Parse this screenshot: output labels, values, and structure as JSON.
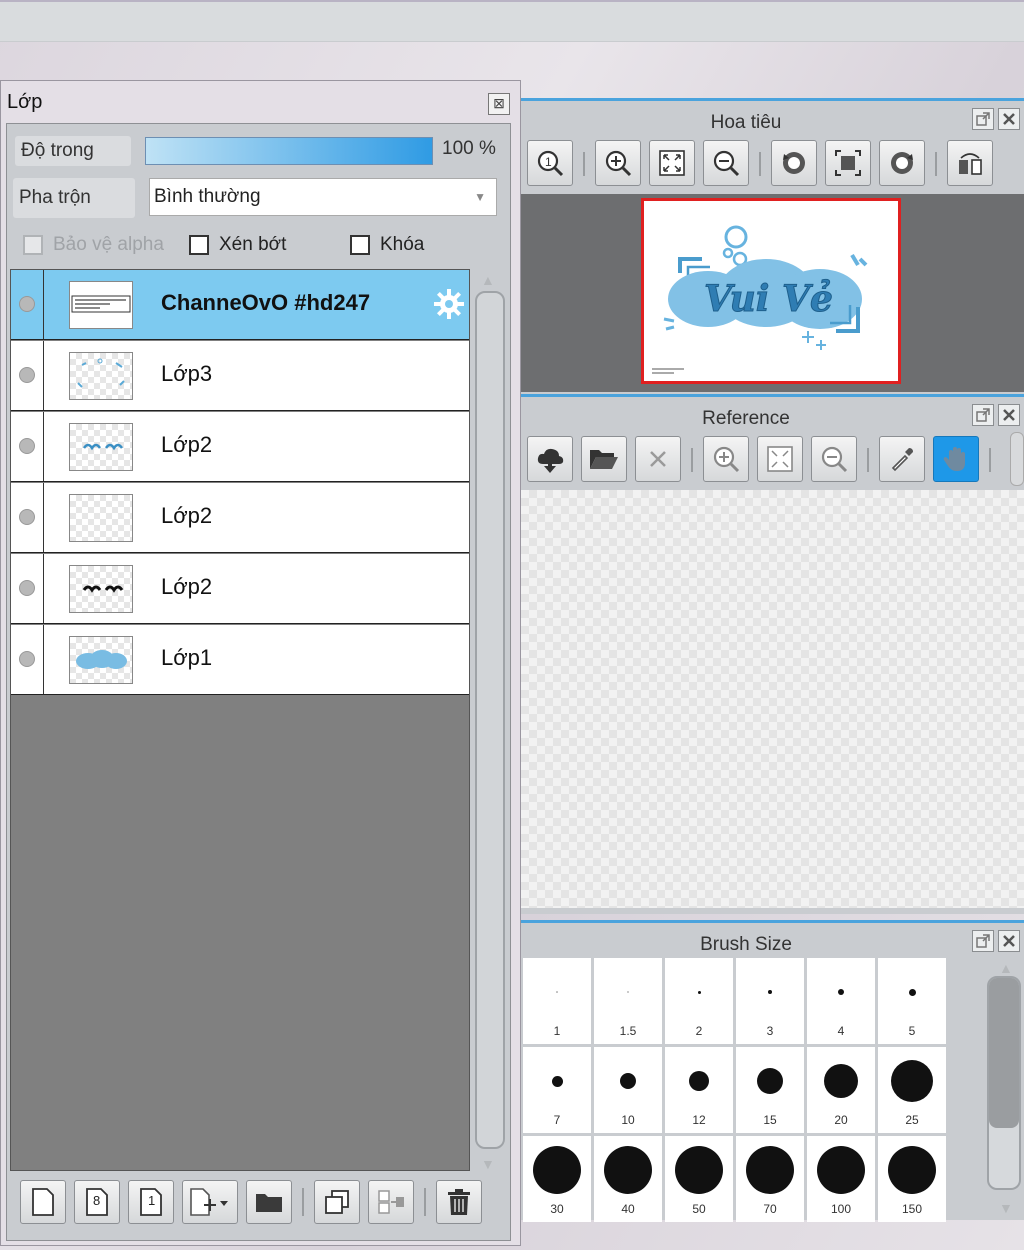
{
  "layers_panel": {
    "title": "Lớp",
    "close_glyph": "⊠",
    "opacity_label": "Độ trong",
    "opacity_value": "100 %",
    "opacity_level": 1.0,
    "blend_label": "Pha trộn",
    "blend_value": "Bình thường",
    "protect_alpha_label": "Bảo vệ alpha",
    "clip_label": "Xén bớt",
    "lock_label": "Khóa",
    "layers": [
      {
        "name": "ChanneOvO #hd247",
        "selected": true
      },
      {
        "name": "Lớp3",
        "selected": false
      },
      {
        "name": "Lớp2",
        "selected": false
      },
      {
        "name": "Lớp2",
        "selected": false
      },
      {
        "name": "Lớp2",
        "selected": false
      },
      {
        "name": "Lớp1",
        "selected": false
      }
    ],
    "toolbar": {
      "new_layer_icon": "new-layer-icon",
      "layer8_label": "8",
      "layer1_label": "1",
      "folder_icon": "folder-icon",
      "duplicate_icon": "duplicate-icon",
      "merge_icon": "merge-icon",
      "delete_icon": "trash-icon"
    }
  },
  "navigator": {
    "title": "Hoa tiêu",
    "preview_text": "Vui Vẻ"
  },
  "reference": {
    "title": "Reference"
  },
  "brush_size": {
    "title": "Brush Size",
    "sizes": [
      "1",
      "1.5",
      "2",
      "3",
      "4",
      "5",
      "7",
      "10",
      "12",
      "15",
      "20",
      "25",
      "30",
      "40",
      "50",
      "70",
      "100",
      "150"
    ]
  },
  "colors": {
    "accent": "#4aa3dd",
    "selected_layer": "#7dcaf0",
    "active_tool": "#1e98e8"
  }
}
